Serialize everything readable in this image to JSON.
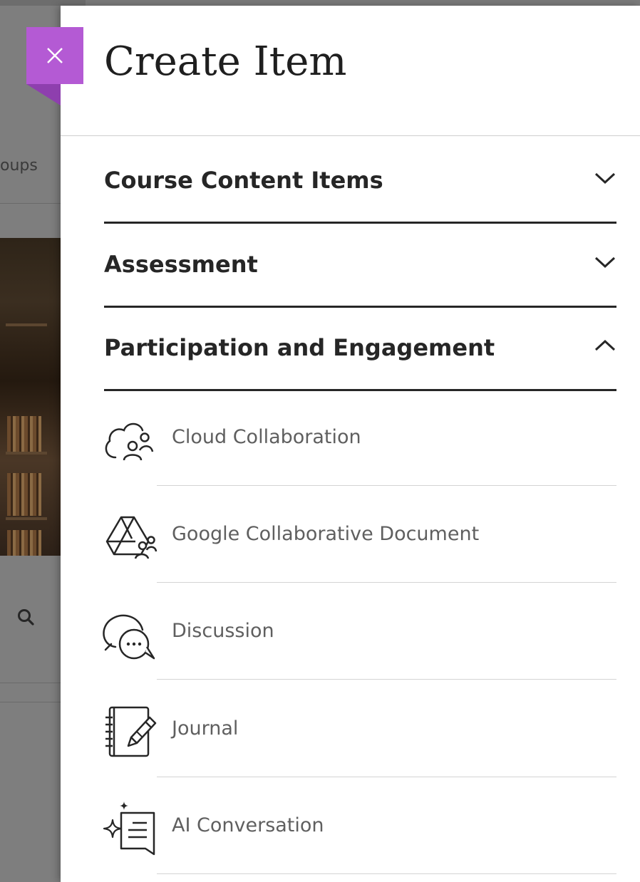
{
  "background": {
    "tab_fragment": "oups"
  },
  "panel": {
    "title": "Create Item",
    "close_glyph": "×",
    "accent_color": "#b45ad4"
  },
  "sections": [
    {
      "label": "Course Content Items",
      "state": "collapsed",
      "icon": "chevron-down-icon"
    },
    {
      "label": "Assessment",
      "state": "collapsed",
      "icon": "chevron-down-icon"
    },
    {
      "label": "Participation and Engagement",
      "state": "expanded",
      "icon": "chevron-up-icon"
    }
  ],
  "items": [
    {
      "label": "Cloud Collaboration",
      "icon": "cloud-collaboration-icon"
    },
    {
      "label": "Google Collaborative Document",
      "icon": "google-collaborative-document-icon"
    },
    {
      "label": "Discussion",
      "icon": "discussion-icon"
    },
    {
      "label": "Journal",
      "icon": "journal-icon"
    },
    {
      "label": "AI Conversation",
      "icon": "ai-conversation-icon"
    }
  ]
}
